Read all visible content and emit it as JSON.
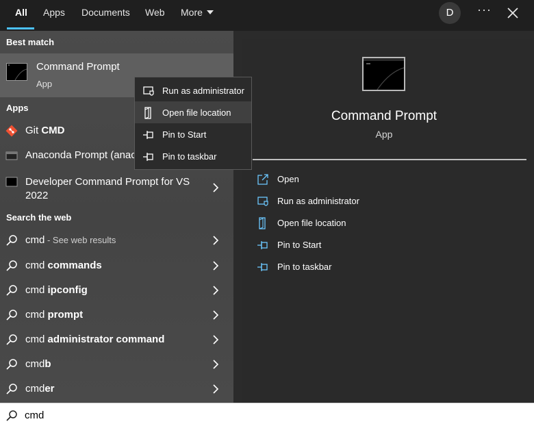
{
  "tabs": [
    {
      "label": "All"
    },
    {
      "label": "Apps"
    },
    {
      "label": "Documents"
    },
    {
      "label": "Web"
    },
    {
      "label": "More"
    }
  ],
  "account": {
    "initial": "D"
  },
  "toolbar": {
    "more_options": "···"
  },
  "left": {
    "best_match_title": "Best match",
    "best_match": {
      "name": "Command Prompt",
      "type": "App"
    },
    "apps_title": "Apps",
    "apps": [
      {
        "name_plain": "Git ",
        "name_bold": "CMD"
      },
      {
        "name_plain": "Anaconda Prompt (anac"
      },
      {
        "name_line1": "Developer Command Prompt for VS",
        "name_line2": "2022"
      }
    ],
    "web_title": "Search the web",
    "web": [
      {
        "plain": "cmd",
        "suffix": " - See web results"
      },
      {
        "plain": "cmd ",
        "bold": "commands"
      },
      {
        "plain": "cmd ",
        "bold": "ipconfig"
      },
      {
        "plain": "cmd ",
        "bold": "prompt"
      },
      {
        "plain": "cmd ",
        "bold": "administrator command"
      },
      {
        "plain": "cmd",
        "bold": "b"
      },
      {
        "plain": "cmd",
        "bold": "er"
      }
    ]
  },
  "context_menu": {
    "items": [
      {
        "label": "Run as administrator",
        "icon": "shield-run-icon"
      },
      {
        "label": "Open file location",
        "icon": "folder-location-icon"
      },
      {
        "label": "Pin to Start",
        "icon": "pin-icon"
      },
      {
        "label": "Pin to taskbar",
        "icon": "pin-icon"
      }
    ],
    "hovered_index": 1
  },
  "preview": {
    "title": "Command Prompt",
    "subtitle": "App",
    "actions": [
      {
        "label": "Open",
        "icon": "open-icon"
      },
      {
        "label": "Run as administrator",
        "icon": "shield-run-icon"
      },
      {
        "label": "Open file location",
        "icon": "folder-location-icon"
      },
      {
        "label": "Pin to Start",
        "icon": "pin-icon"
      },
      {
        "label": "Pin to taskbar",
        "icon": "pin-icon"
      }
    ]
  },
  "search": {
    "value": "cmd"
  },
  "colors": {
    "accent": "#4cc2ff",
    "icon_stroke": "#6cc8ff"
  }
}
